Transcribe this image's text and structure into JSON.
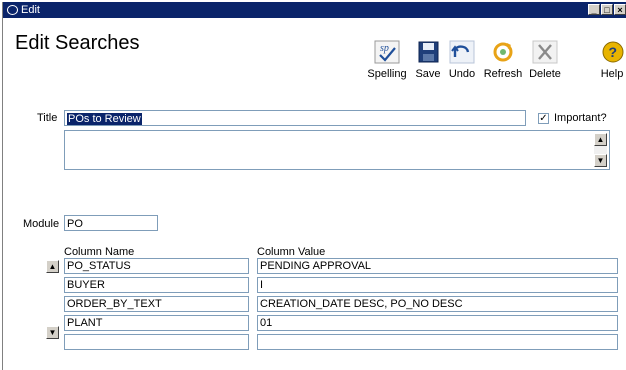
{
  "window": {
    "title": "Edit"
  },
  "header": {
    "title": "Edit Searches"
  },
  "toolbar": {
    "spelling": "Spelling",
    "save": "Save",
    "undo": "Undo",
    "refresh": "Refresh",
    "delete": "Delete",
    "help": "Help"
  },
  "form": {
    "title_label": "Title",
    "title_value": "POs to Review",
    "important_label": "Important?",
    "important_checked": true,
    "module_label": "Module",
    "module_value": "PO"
  },
  "grid": {
    "headers": {
      "name": "Column Name",
      "value": "Column Value"
    },
    "rows": [
      {
        "name": "PO_STATUS",
        "value": "PENDING APPROVAL"
      },
      {
        "name": "BUYER",
        "value": "I"
      },
      {
        "name": "ORDER_BY_TEXT",
        "value": "CREATION_DATE DESC, PO_NO DESC"
      },
      {
        "name": "PLANT",
        "value": "01"
      },
      {
        "name": "",
        "value": ""
      }
    ]
  },
  "colors": {
    "titlebar": "#0a246a",
    "accent_blue": "#1f4f9a",
    "icon_orange": "#e8a317"
  }
}
